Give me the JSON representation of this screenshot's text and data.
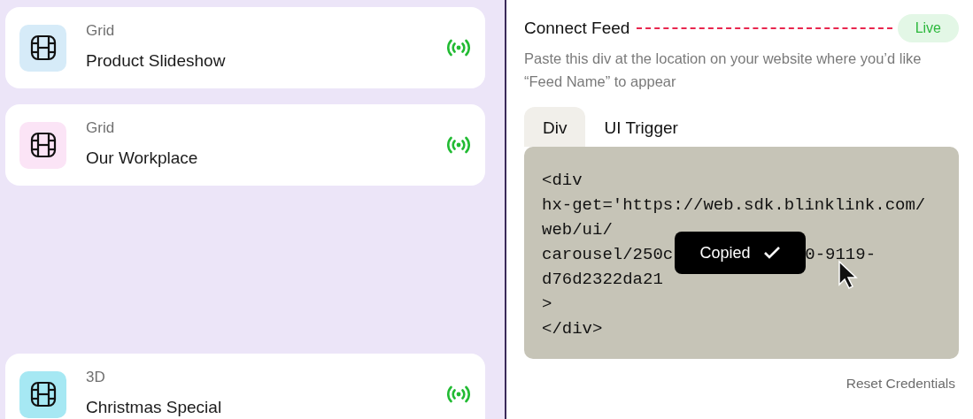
{
  "feeds": [
    {
      "type": "Grid",
      "name": "Product Slideshow",
      "color": "#d6ebf8",
      "live": true
    },
    {
      "type": "Grid",
      "name": "Our Workplace",
      "color": "#fbe4f6",
      "live": true
    },
    {
      "type": "3D",
      "name": "Christmas Special",
      "color": "#a6e8f3",
      "live": true
    }
  ],
  "connect": {
    "title": "Connect Feed",
    "status": "Live",
    "description": "Paste this div at the location on your website where you’d like “Feed Name” to appear",
    "tabs": [
      {
        "label": "Div",
        "selected": true
      },
      {
        "label": "UI Trigger",
        "selected": false
      }
    ],
    "code_lines": [
      {
        "parts": [
          "<div"
        ]
      },
      {
        "parts": [
          "hx-get='https://web.sdk.blinklink.com/"
        ]
      },
      {
        "parts": [
          "web/ui/"
        ]
      },
      {
        "parts": [
          "carousel/250c",
          "0-9119-"
        ]
      },
      {
        "parts": [
          "d76d2322da21"
        ]
      },
      {
        "parts": [
          ">"
        ]
      },
      {
        "parts": [
          "</div>"
        ]
      }
    ],
    "tooltip": "Copied",
    "reset": "Reset Credentials"
  }
}
